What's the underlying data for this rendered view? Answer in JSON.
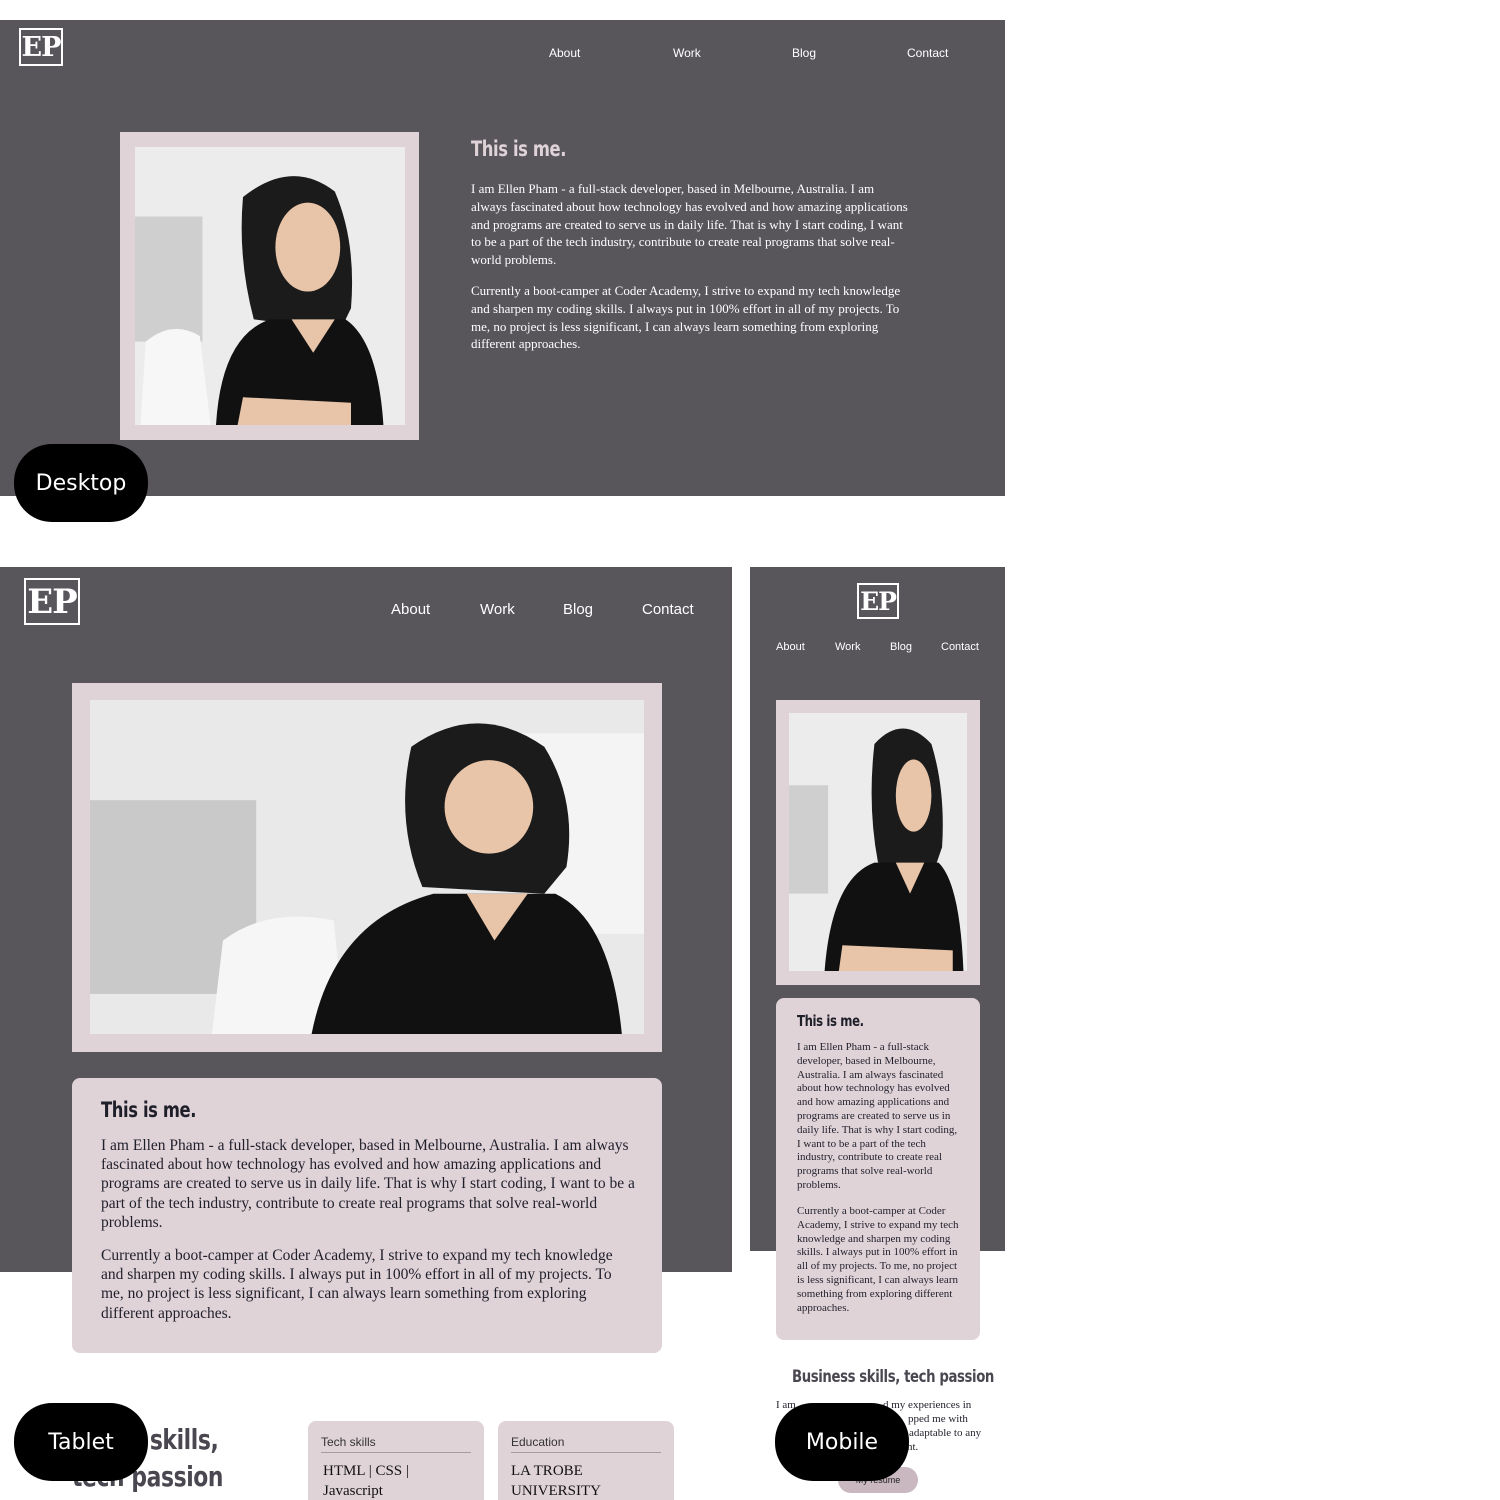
{
  "brand": {
    "logo": "EP"
  },
  "nav": {
    "about": "About",
    "work": "Work",
    "blog": "Blog",
    "contact": "Contact"
  },
  "about": {
    "heading": "This is me.",
    "para1": "I am Ellen Pham - a full-stack developer, based in Melbourne, Australia. I am always fascinated about how technology has evolved and how amazing applications and programs are created to serve us in daily life. That is why I start coding, I want to be a part of the tech industry, contribute to create real programs that solve real-world problems.",
    "para2": "Currently a boot-camper at Coder Academy, I strive to expand my tech knowledge and sharpen my coding skills. I always put in 100% effort in all of my projects. To me, no project is less significant, I can always learn something from exploring different approaches."
  },
  "skills_section": {
    "heading": "Business skills, tech passion",
    "tablet_heading_line1": "s skills,",
    "tablet_heading_line2": "tech passion",
    "intro_fragment_start": "I am",
    "intro_fragment_mid": "d my experiences in",
    "intro_fragment_mid2": "pped me with",
    "intro_fragment_mid3": "adaptable to any",
    "intro_fragment_end": "nt.",
    "resume_button": "My resume"
  },
  "cards": {
    "tech_label": "Tech skills",
    "tech_value": "HTML | CSS | Javascript",
    "education_label": "Education",
    "education_value": "LA TROBE UNIVERSITY"
  },
  "labels": {
    "desktop": "Desktop",
    "tablet": "Tablet",
    "mobile": "Mobile"
  },
  "colors": {
    "dark_bg": "#58555b",
    "accent_pink": "#e0d3d8",
    "label_bg": "#000000"
  }
}
